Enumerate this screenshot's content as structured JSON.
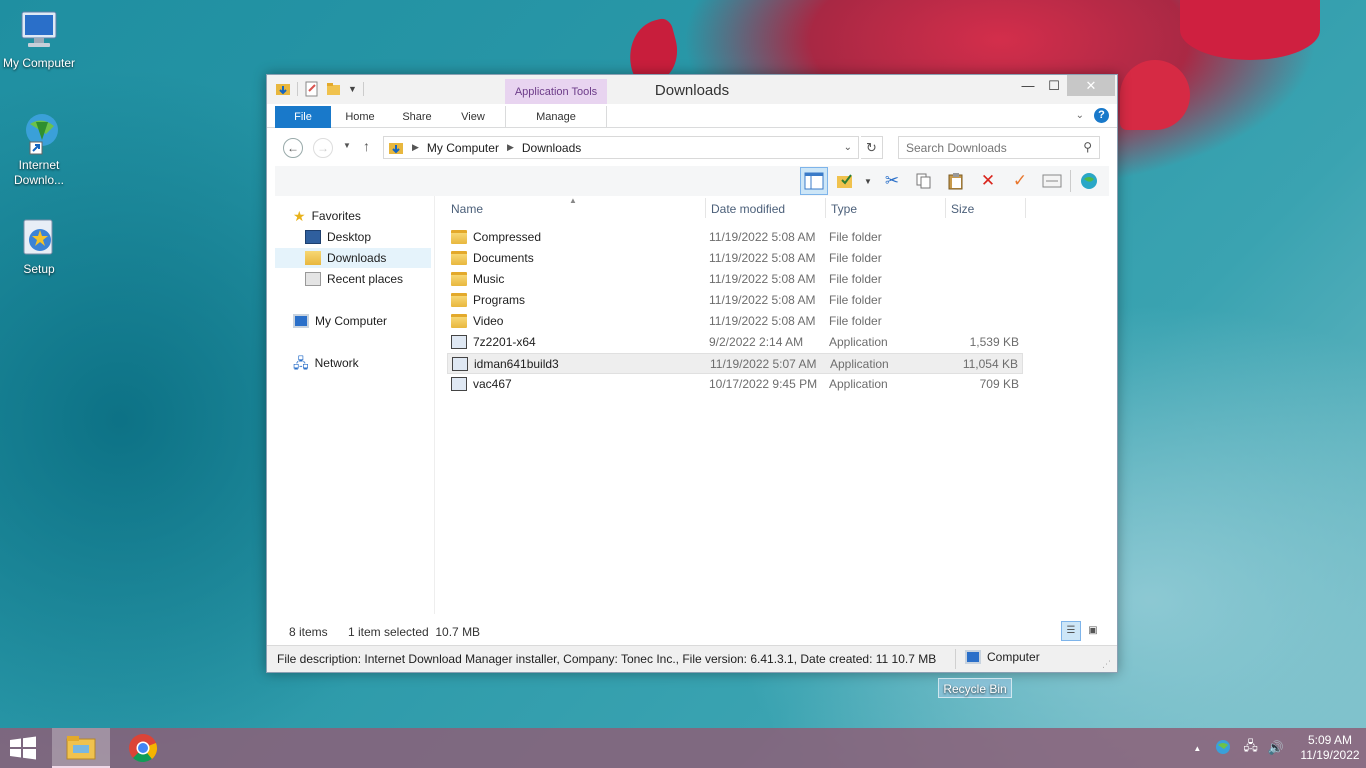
{
  "desktop": {
    "icons": [
      {
        "label": "My Computer",
        "icon": "computer-icon"
      },
      {
        "label": "Internet Downlo...",
        "icon": "idm-icon"
      },
      {
        "label": "Setup",
        "icon": "setup-icon"
      }
    ],
    "recycle_bin_label": "Recycle Bin"
  },
  "window": {
    "title": "Downloads",
    "contextual_tab_group": "Application Tools",
    "tabs": [
      "File",
      "Home",
      "Share",
      "View",
      "Manage"
    ],
    "min_glyph": "—",
    "max_glyph": "☐",
    "close_glyph": "✕",
    "address": {
      "segments": [
        "My Computer",
        "Downloads"
      ]
    },
    "search": {
      "placeholder": "Search Downloads"
    },
    "nav_pane": {
      "favorites": "Favorites",
      "desktop": "Desktop",
      "downloads": "Downloads",
      "recent": "Recent places",
      "computer": "My Computer",
      "network": "Network"
    },
    "columns": {
      "name": "Name",
      "date": "Date modified",
      "type": "Type",
      "size": "Size"
    },
    "files": [
      {
        "name": "Compressed",
        "date": "11/19/2022 5:08 AM",
        "type": "File folder",
        "size": "",
        "kind": "folder"
      },
      {
        "name": "Documents",
        "date": "11/19/2022 5:08 AM",
        "type": "File folder",
        "size": "",
        "kind": "folder"
      },
      {
        "name": "Music",
        "date": "11/19/2022 5:08 AM",
        "type": "File folder",
        "size": "",
        "kind": "folder"
      },
      {
        "name": "Programs",
        "date": "11/19/2022 5:08 AM",
        "type": "File folder",
        "size": "",
        "kind": "folder"
      },
      {
        "name": "Video",
        "date": "11/19/2022 5:08 AM",
        "type": "File folder",
        "size": "",
        "kind": "folder"
      },
      {
        "name": "7z2201-x64",
        "date": "9/2/2022 2:14 AM",
        "type": "Application",
        "size": "1,539 KB",
        "kind": "app"
      },
      {
        "name": "idman641build3",
        "date": "11/19/2022 5:07 AM",
        "type": "Application",
        "size": "11,054 KB",
        "kind": "app",
        "selected": true
      },
      {
        "name": "vac467",
        "date": "10/17/2022 9:45 PM",
        "type": "Application",
        "size": "709 KB",
        "kind": "app"
      }
    ],
    "status": {
      "item_count": "8 items",
      "selection": "1 item selected  10.7 MB"
    },
    "details_bar": {
      "description": "File description: Internet Download Manager installer, Company: Tonec Inc., File version: 6.41.3.1, Date created: 11 10.7 MB",
      "location": "Computer"
    }
  },
  "taskbar": {
    "time": "5:09 AM",
    "date": "11/19/2022",
    "tray_expand_glyph": "▲"
  },
  "colors": {
    "accent": "#1979ca",
    "contextual_tab": "#e8d4f0",
    "selection": "#cde6f7"
  }
}
